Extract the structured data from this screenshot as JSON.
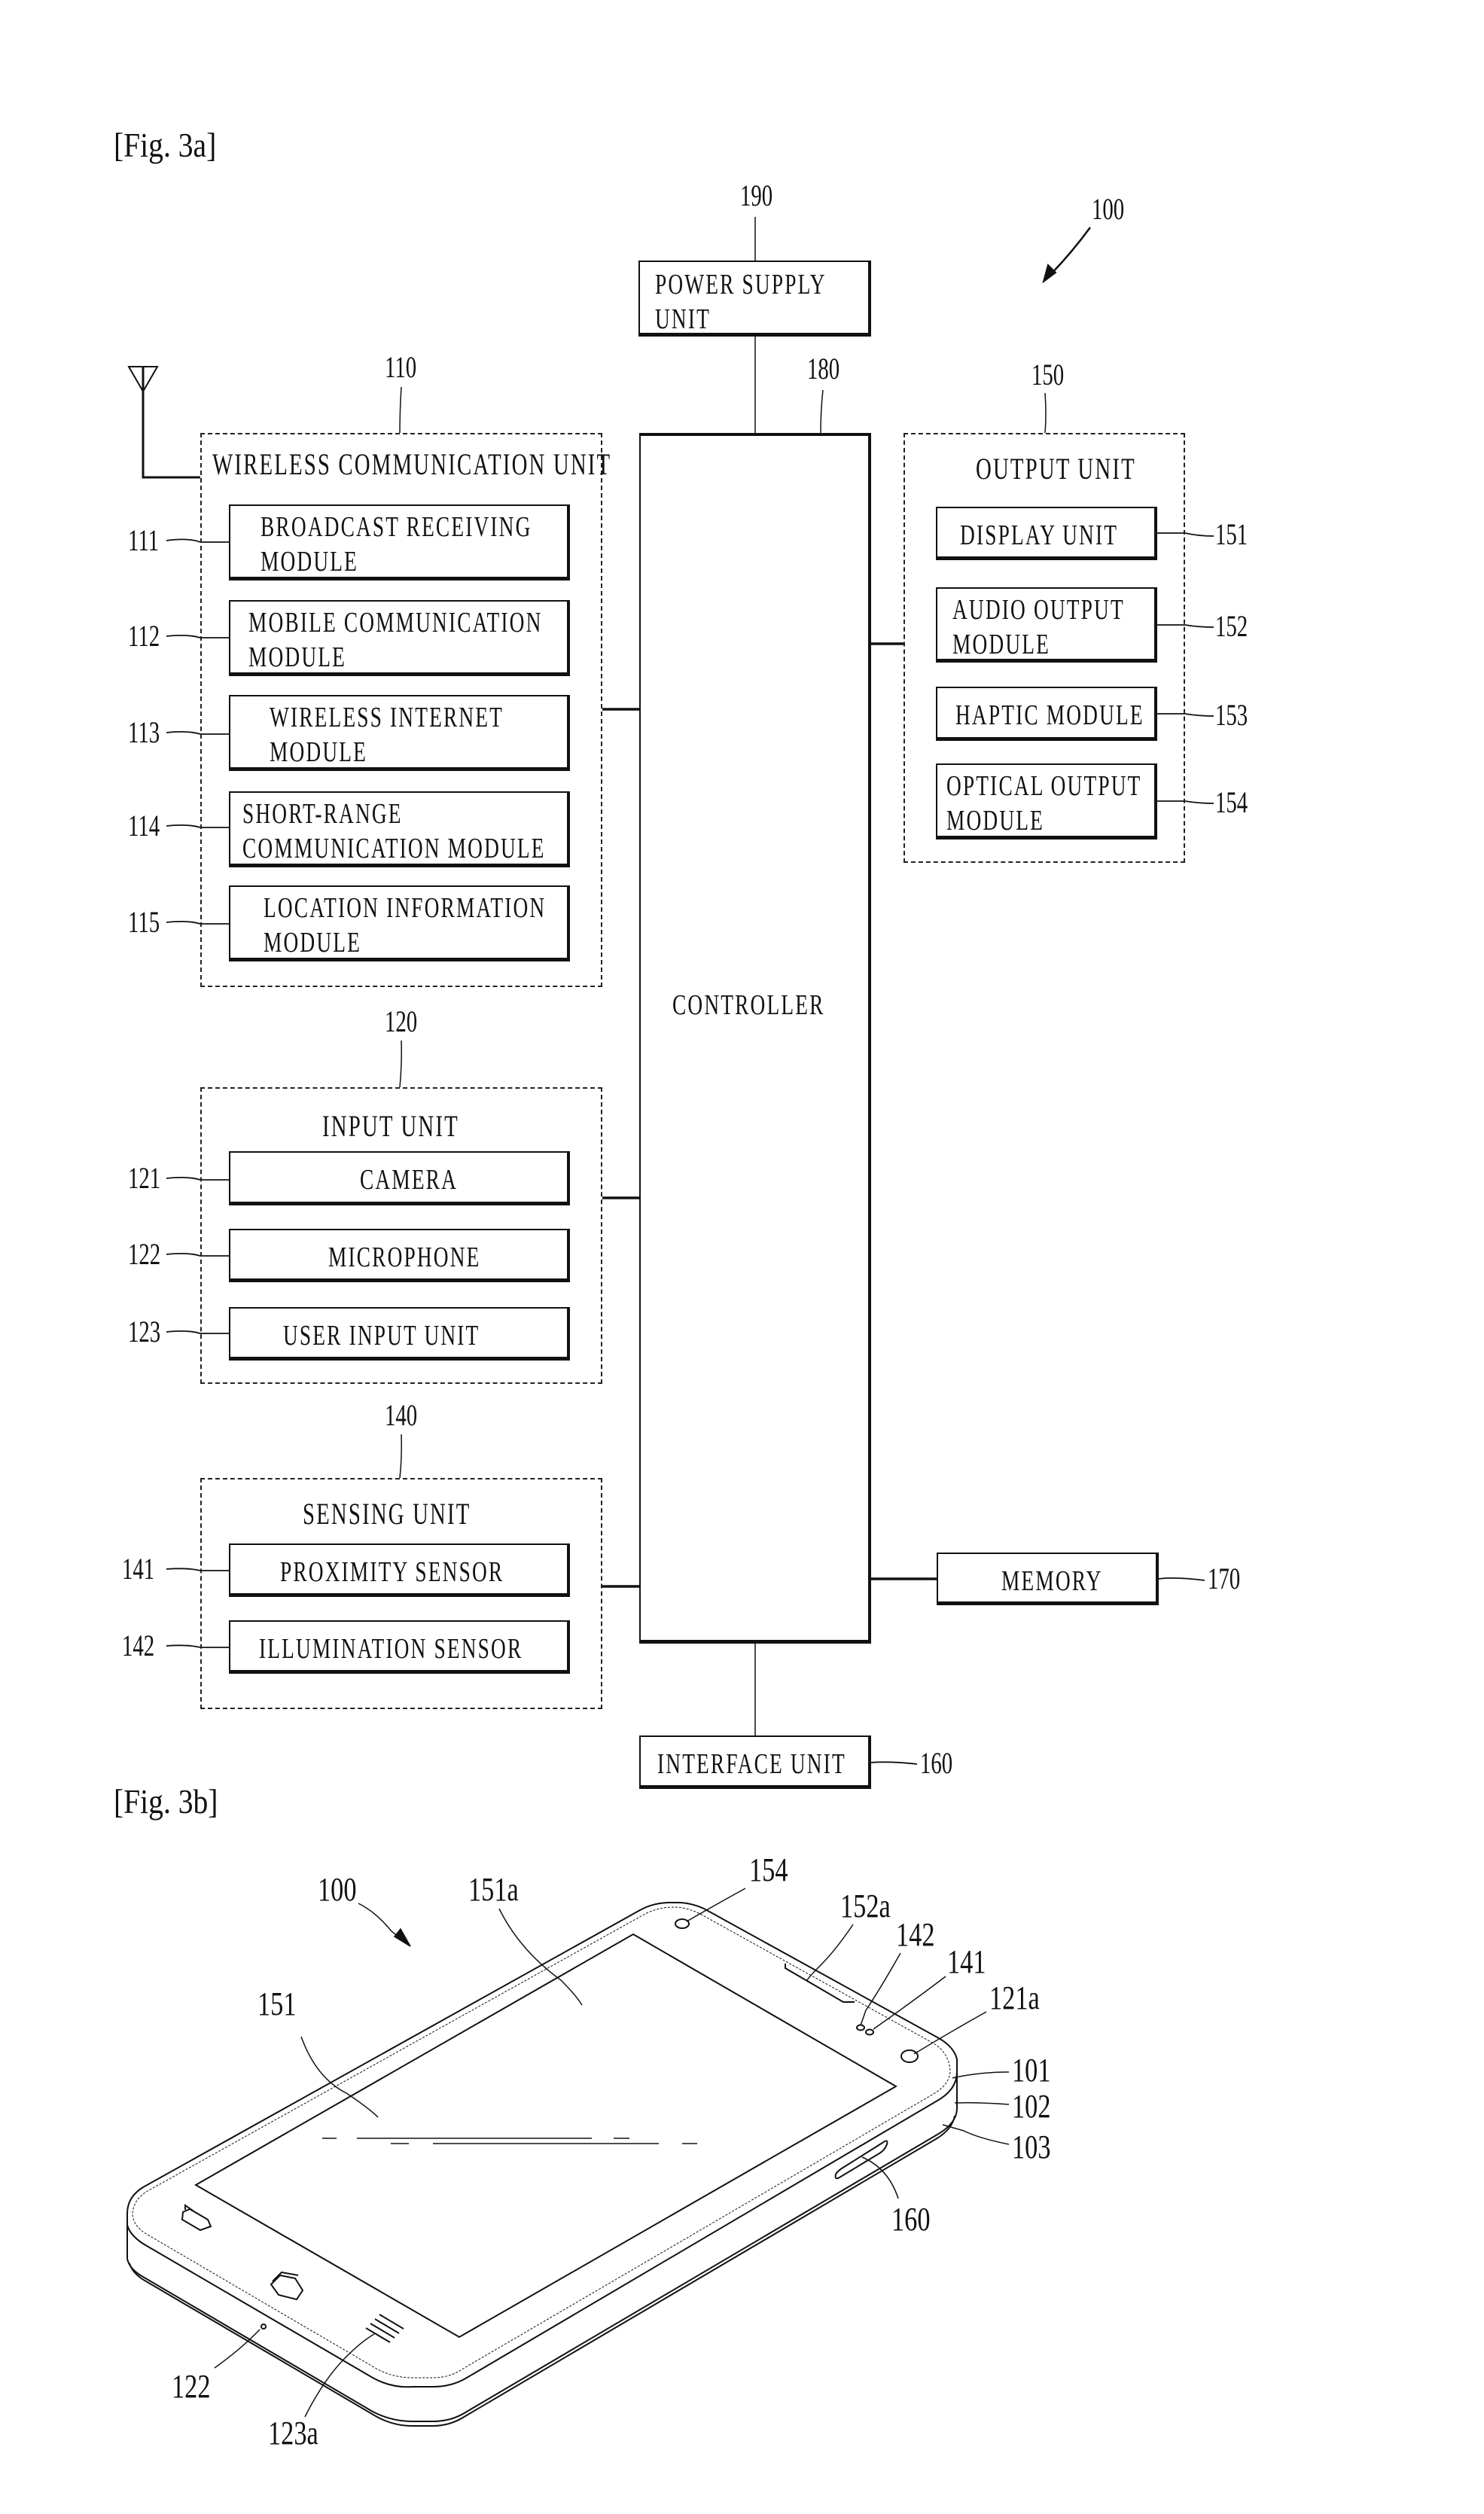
{
  "figures": {
    "fig3a_label": "[Fig. 3a]",
    "fig3b_label": "[Fig. 3b]"
  },
  "fig3a": {
    "device_ref": "100",
    "power_supply": {
      "ref": "190",
      "line1": "POWER SUPPLY",
      "line2": "UNIT"
    },
    "controller": {
      "ref": "180",
      "label": "CONTROLLER"
    },
    "wireless_unit": {
      "ref": "110",
      "title": "WIRELESS COMMUNICATION UNIT",
      "modules": [
        {
          "ref": "111",
          "line1": "BROADCAST RECEIVING",
          "line2": "MODULE"
        },
        {
          "ref": "112",
          "line1": "MOBILE COMMUNICATION",
          "line2": "MODULE"
        },
        {
          "ref": "113",
          "line1": "WIRELESS INTERNET",
          "line2": "MODULE"
        },
        {
          "ref": "114",
          "line1": "SHORT-RANGE",
          "line2": "COMMUNICATION MODULE"
        },
        {
          "ref": "115",
          "line1": "LOCATION INFORMATION",
          "line2": "MODULE"
        }
      ]
    },
    "input_unit": {
      "ref": "120",
      "title": "INPUT UNIT",
      "modules": [
        {
          "ref": "121",
          "label": "CAMERA"
        },
        {
          "ref": "122",
          "label": "MICROPHONE"
        },
        {
          "ref": "123",
          "label": "USER INPUT UNIT"
        }
      ]
    },
    "sensing_unit": {
      "ref": "140",
      "title": "SENSING UNIT",
      "modules": [
        {
          "ref": "141",
          "label": "PROXIMITY SENSOR"
        },
        {
          "ref": "142",
          "label": "ILLUMINATION SENSOR"
        }
      ]
    },
    "output_unit": {
      "ref": "150",
      "title": "OUTPUT UNIT",
      "modules": [
        {
          "ref": "151",
          "line1": "DISPLAY UNIT",
          "line2": ""
        },
        {
          "ref": "152",
          "line1": "AUDIO OUTPUT",
          "line2": "MODULE"
        },
        {
          "ref": "153",
          "line1": "HAPTIC MODULE",
          "line2": ""
        },
        {
          "ref": "154",
          "line1": "OPTICAL OUTPUT",
          "line2": "MODULE"
        }
      ]
    },
    "memory": {
      "ref": "170",
      "label": "MEMORY"
    },
    "interface_unit": {
      "ref": "160",
      "label": "INTERFACE UNIT"
    }
  },
  "fig3b": {
    "refs": {
      "device": "100",
      "display_area": "151a",
      "display": "151",
      "optical_output": "154",
      "audio_output": "152a",
      "illumination_sensor": "142",
      "proximity_sensor": "141",
      "camera": "121a",
      "front_case": "101",
      "rear_case": "102",
      "rear_cover": "103",
      "interface": "160",
      "microphone": "122",
      "user_input": "123a"
    }
  }
}
